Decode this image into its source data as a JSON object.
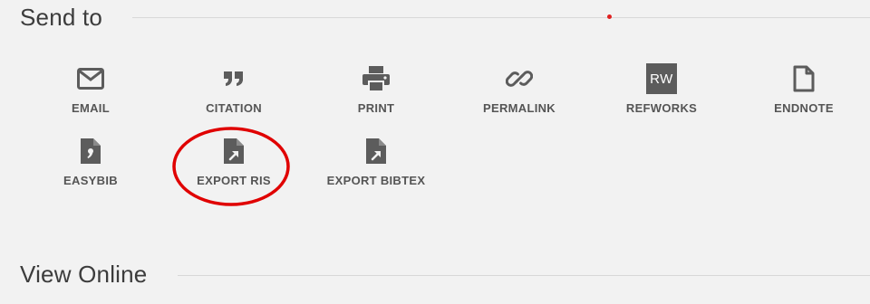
{
  "send_to": {
    "title": "Send to",
    "actions": [
      {
        "id": "email",
        "label": "EMAIL",
        "icon": "envelope-icon"
      },
      {
        "id": "citation",
        "label": "CITATION",
        "icon": "quote-icon"
      },
      {
        "id": "print",
        "label": "PRINT",
        "icon": "printer-icon"
      },
      {
        "id": "permalink",
        "label": "PERMALINK",
        "icon": "link-icon"
      },
      {
        "id": "refworks",
        "label": "REFWORKS",
        "icon": "refworks-icon",
        "badge": "RW"
      },
      {
        "id": "endnote",
        "label": "ENDNOTE",
        "icon": "document-icon"
      },
      {
        "id": "easybib",
        "label": "EASYBIB",
        "icon": "easybib-icon"
      },
      {
        "id": "export-ris",
        "label": "EXPORT RIS",
        "icon": "export-file-icon"
      },
      {
        "id": "export-bibtex",
        "label": "EXPORT BIBTEX",
        "icon": "export-file-icon"
      }
    ]
  },
  "view_online": {
    "title": "View Online"
  },
  "colors": {
    "background": "#f2f2f2",
    "icon": "#5c5c5c",
    "label": "#555555",
    "annotation": "#e00000",
    "indicator_dot": "#e02020"
  }
}
